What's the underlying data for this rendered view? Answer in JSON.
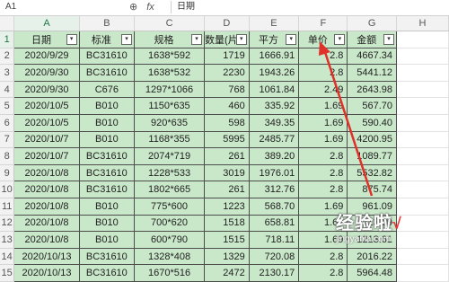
{
  "formula_bar": {
    "name_box": "A1",
    "zoom_icon": "magnifier-icon",
    "fx_label": "fx",
    "content": "日期"
  },
  "columns": [
    "A",
    "B",
    "C",
    "D",
    "E",
    "F",
    "G",
    "H"
  ],
  "headers": [
    "日期",
    "标准",
    "规格",
    "数量(片",
    "平方",
    "单价",
    "金额"
  ],
  "rows": [
    {
      "n": "2",
      "cells": [
        "2020/9/29",
        "BC31610",
        "1638*592",
        "1719",
        "1666.91",
        "2.8",
        "4667.34"
      ]
    },
    {
      "n": "3",
      "cells": [
        "2020/9/30",
        "BC31610",
        "1638*532",
        "2230",
        "1943.26",
        "2.8",
        "5441.12"
      ]
    },
    {
      "n": "4",
      "cells": [
        "2020/9/30",
        "C676",
        "1297*1066",
        "768",
        "1061.84",
        "2.49",
        "2643.98"
      ]
    },
    {
      "n": "5",
      "cells": [
        "2020/10/5",
        "B010",
        "1150*635",
        "460",
        "335.92",
        "1.69",
        "567.70"
      ]
    },
    {
      "n": "6",
      "cells": [
        "2020/10/5",
        "B010",
        "920*635",
        "598",
        "349.35",
        "1.69",
        "590.40"
      ]
    },
    {
      "n": "7",
      "cells": [
        "2020/10/7",
        "B010",
        "1168*355",
        "5995",
        "2485.77",
        "1.69",
        "4200.95"
      ]
    },
    {
      "n": "8",
      "cells": [
        "2020/10/7",
        "BC31610",
        "2074*719",
        "261",
        "389.20",
        "2.8",
        "1089.77"
      ]
    },
    {
      "n": "9",
      "cells": [
        "2020/10/8",
        "BC31610",
        "1228*533",
        "3019",
        "1976.01",
        "2.8",
        "5532.82"
      ]
    },
    {
      "n": "10",
      "cells": [
        "2020/10/8",
        "BC31610",
        "1802*665",
        "261",
        "312.76",
        "2.8",
        "875.74"
      ]
    },
    {
      "n": "11",
      "cells": [
        "2020/10/8",
        "B010",
        "775*600",
        "1223",
        "568.70",
        "1.69",
        "961.09"
      ]
    },
    {
      "n": "12",
      "cells": [
        "2020/10/8",
        "B010",
        "700*620",
        "1518",
        "658.81",
        "1.69",
        "1113.39"
      ]
    },
    {
      "n": "13",
      "cells": [
        "2020/10/8",
        "B010",
        "600*790",
        "1515",
        "718.11",
        "1.69",
        "1213.61"
      ]
    },
    {
      "n": "14",
      "cells": [
        "2020/10/13",
        "BC31610",
        "1328*408",
        "1329",
        "720.08",
        "2.8",
        "2016.22"
      ]
    },
    {
      "n": "15",
      "cells": [
        "2020/10/13",
        "BC31610",
        "1670*516",
        "2472",
        "2130.17",
        "2.8",
        "5964.48"
      ]
    }
  ],
  "watermark": {
    "text": "经验啦",
    "check": "√",
    "url": "jingyanla.com"
  },
  "colors": {
    "cell_fill": "#c9e7c9",
    "arrow": "#e0302a"
  }
}
